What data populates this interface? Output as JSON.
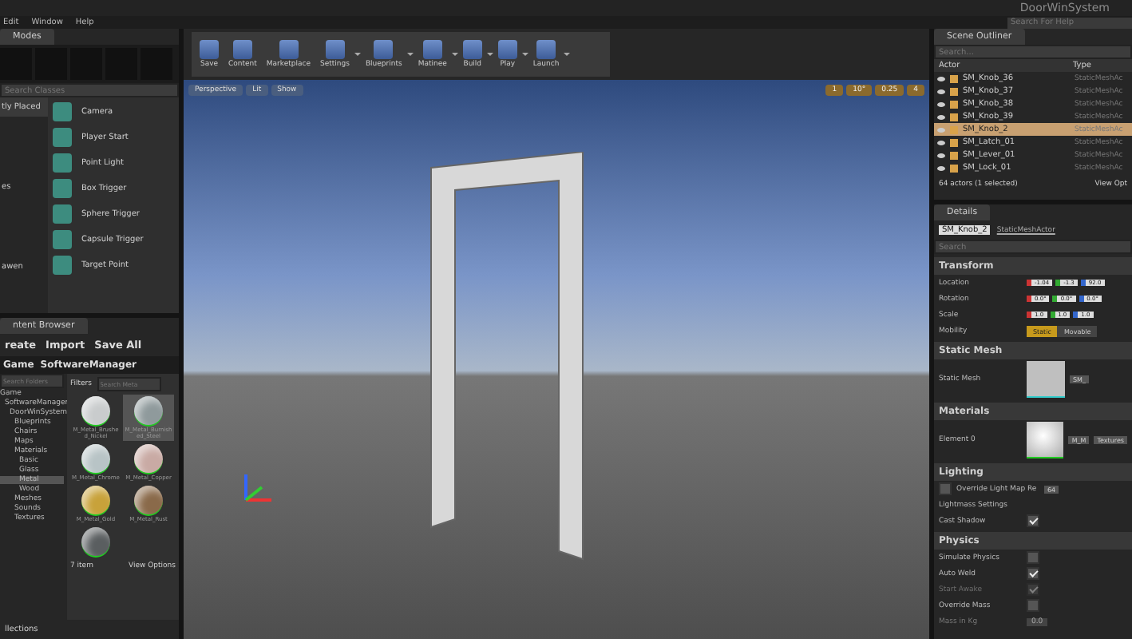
{
  "title_bar": {
    "project": "DoorWinSystem",
    "help_search": {
      "placeholder": "Search For Help"
    }
  },
  "menu": [
    "Edit",
    "Window",
    "Help"
  ],
  "modes": {
    "tab": "Modes",
    "search": {
      "placeholder": "Search Classes"
    },
    "categories": [
      {
        "label": "tly Placed",
        "selected": true
      },
      {
        "label": "es",
        "selected": false
      },
      {
        "label": "awen",
        "selected": false
      }
    ],
    "items": [
      {
        "label": "Camera"
      },
      {
        "label": "Player Start"
      },
      {
        "label": "Point Light"
      },
      {
        "label": "Box Trigger"
      },
      {
        "label": "Sphere Trigger"
      },
      {
        "label": "Capsule Trigger"
      },
      {
        "label": "Target Point"
      }
    ]
  },
  "content_browser": {
    "tab": "ntent Browser",
    "create": "reate",
    "import": "Import",
    "save_all": "Save All",
    "path": [
      "Game",
      "SoftwareManager"
    ],
    "folder_search": {
      "placeholder": "Search Folders"
    },
    "tree": [
      {
        "label": "Game",
        "selected": false,
        "children": [
          {
            "label": "SoftwareManager",
            "selected": false,
            "children": [
              {
                "label": "DoorWinSystem",
                "selected": false,
                "children": [
                  {
                    "label": "Blueprints",
                    "selected": false
                  },
                  {
                    "label": "Chairs",
                    "selected": false
                  },
                  {
                    "label": "Maps",
                    "selected": false
                  },
                  {
                    "label": "Materials",
                    "selected": false,
                    "children": [
                      {
                        "label": "Basic",
                        "selected": false
                      },
                      {
                        "label": "Glass",
                        "selected": false
                      },
                      {
                        "label": "Metal",
                        "selected": true
                      },
                      {
                        "label": "Wood",
                        "selected": false
                      }
                    ]
                  },
                  {
                    "label": "Meshes",
                    "selected": false
                  },
                  {
                    "label": "Sounds",
                    "selected": false
                  },
                  {
                    "label": "Textures",
                    "selected": false
                  }
                ]
              }
            ]
          }
        ]
      }
    ],
    "filters": "Filters",
    "asset_search": {
      "placeholder": "Search Meta"
    },
    "assets": [
      {
        "label": "M_Metal_Brushed_Nickel",
        "color": "#c9cccd",
        "selected": false
      },
      {
        "label": "M_Metal_Burnished_Steel",
        "color": "#8f9a9c",
        "selected": true
      },
      {
        "label": "M_Metal_Chrome",
        "color": "#b8c4c6",
        "selected": false
      },
      {
        "label": "M_Metal_Copper",
        "color": "#c9aaa4",
        "selected": false
      },
      {
        "label": "M_Metal_Gold",
        "color": "#c8a23a",
        "selected": false
      },
      {
        "label": "M_Metal_Rust",
        "color": "#8a6a4a",
        "selected": false
      },
      {
        "color": "#5a5e60",
        "selected": false
      }
    ],
    "item_count": "7 item",
    "view_options": "View Options",
    "collections": "llections"
  },
  "toolbar": [
    {
      "label": "Save",
      "menu": false
    },
    {
      "label": "Content",
      "menu": false
    },
    {
      "label": "Marketplace",
      "menu": false
    },
    {
      "label": "Settings",
      "menu": true
    },
    {
      "label": "Blueprints",
      "menu": true
    },
    {
      "label": "Matinee",
      "menu": true
    },
    {
      "label": "Build",
      "menu": true
    },
    {
      "label": "Play",
      "menu": true
    },
    {
      "label": "Launch",
      "menu": true
    }
  ],
  "viewport": {
    "buttons": [
      "Perspective",
      "Lit",
      "Show"
    ],
    "snap_values": [
      "1",
      "10°",
      "0.25",
      "4"
    ]
  },
  "outliner": {
    "tab": "Scene Outliner",
    "search": {
      "placeholder": "Search..."
    },
    "columns": [
      "Actor",
      "Type"
    ],
    "rows": [
      {
        "actor": "SM_Knob_36",
        "type": "StaticMeshAc",
        "selected": false
      },
      {
        "actor": "SM_Knob_37",
        "type": "StaticMeshAc",
        "selected": false
      },
      {
        "actor": "SM_Knob_38",
        "type": "StaticMeshAc",
        "selected": false
      },
      {
        "actor": "SM_Knob_39",
        "type": "StaticMeshAc",
        "selected": false
      },
      {
        "actor": "SM_Knob_2",
        "type": "StaticMeshAc",
        "selected": true
      },
      {
        "actor": "SM_Latch_01",
        "type": "StaticMeshAc",
        "selected": false
      },
      {
        "actor": "SM_Lever_01",
        "type": "StaticMeshAc",
        "selected": false
      },
      {
        "actor": "SM_Lock_01",
        "type": "StaticMeshAc",
        "selected": false
      }
    ],
    "footer": "64 actors (1 selected)",
    "view_options": "View Opt"
  },
  "details": {
    "tab": "Details",
    "name": "SM_Knob_2",
    "class_link": "StaticMeshActor",
    "search": {
      "placeholder": "Search"
    },
    "transform": {
      "title": "Transform",
      "rows": [
        {
          "label": "Location",
          "values": [
            "-1.04",
            "-1.3",
            "92.0"
          ]
        },
        {
          "label": "Rotation",
          "values": [
            "0.0°",
            "0.0°",
            "0.0°"
          ]
        },
        {
          "label": "Scale",
          "values": [
            "1.0",
            "1.0",
            "1.0"
          ]
        }
      ],
      "mobility_label": "Mobility",
      "mobility": [
        {
          "label": "Static",
          "selected": true
        },
        {
          "label": "Movable",
          "selected": false
        }
      ]
    },
    "static_mesh": {
      "title": "Static Mesh",
      "label": "Static Mesh",
      "dropdown": "SM_"
    },
    "materials": {
      "title": "Materials",
      "label": "Element 0",
      "dropdown": "M_M",
      "textures": "Textures"
    },
    "lighting": {
      "title": "Lighting",
      "override_label": "Override Light Map Re",
      "override_checked": false,
      "override_value": "64",
      "lightmass": "Lightmass Settings",
      "cast_shadow_label": "Cast Shadow",
      "cast_shadow": true
    },
    "physics": {
      "title": "Physics",
      "rows": [
        {
          "label": "Simulate Physics",
          "checked": false,
          "disabled": false
        },
        {
          "label": "Auto Weld",
          "checked": true,
          "disabled": false
        },
        {
          "label": "Start Awake",
          "checked": true,
          "disabled": true
        },
        {
          "label": "Override Mass",
          "checked": false,
          "disabled": false
        }
      ],
      "mass_label": "Mass in Kg",
      "mass_value": "0.0"
    }
  }
}
